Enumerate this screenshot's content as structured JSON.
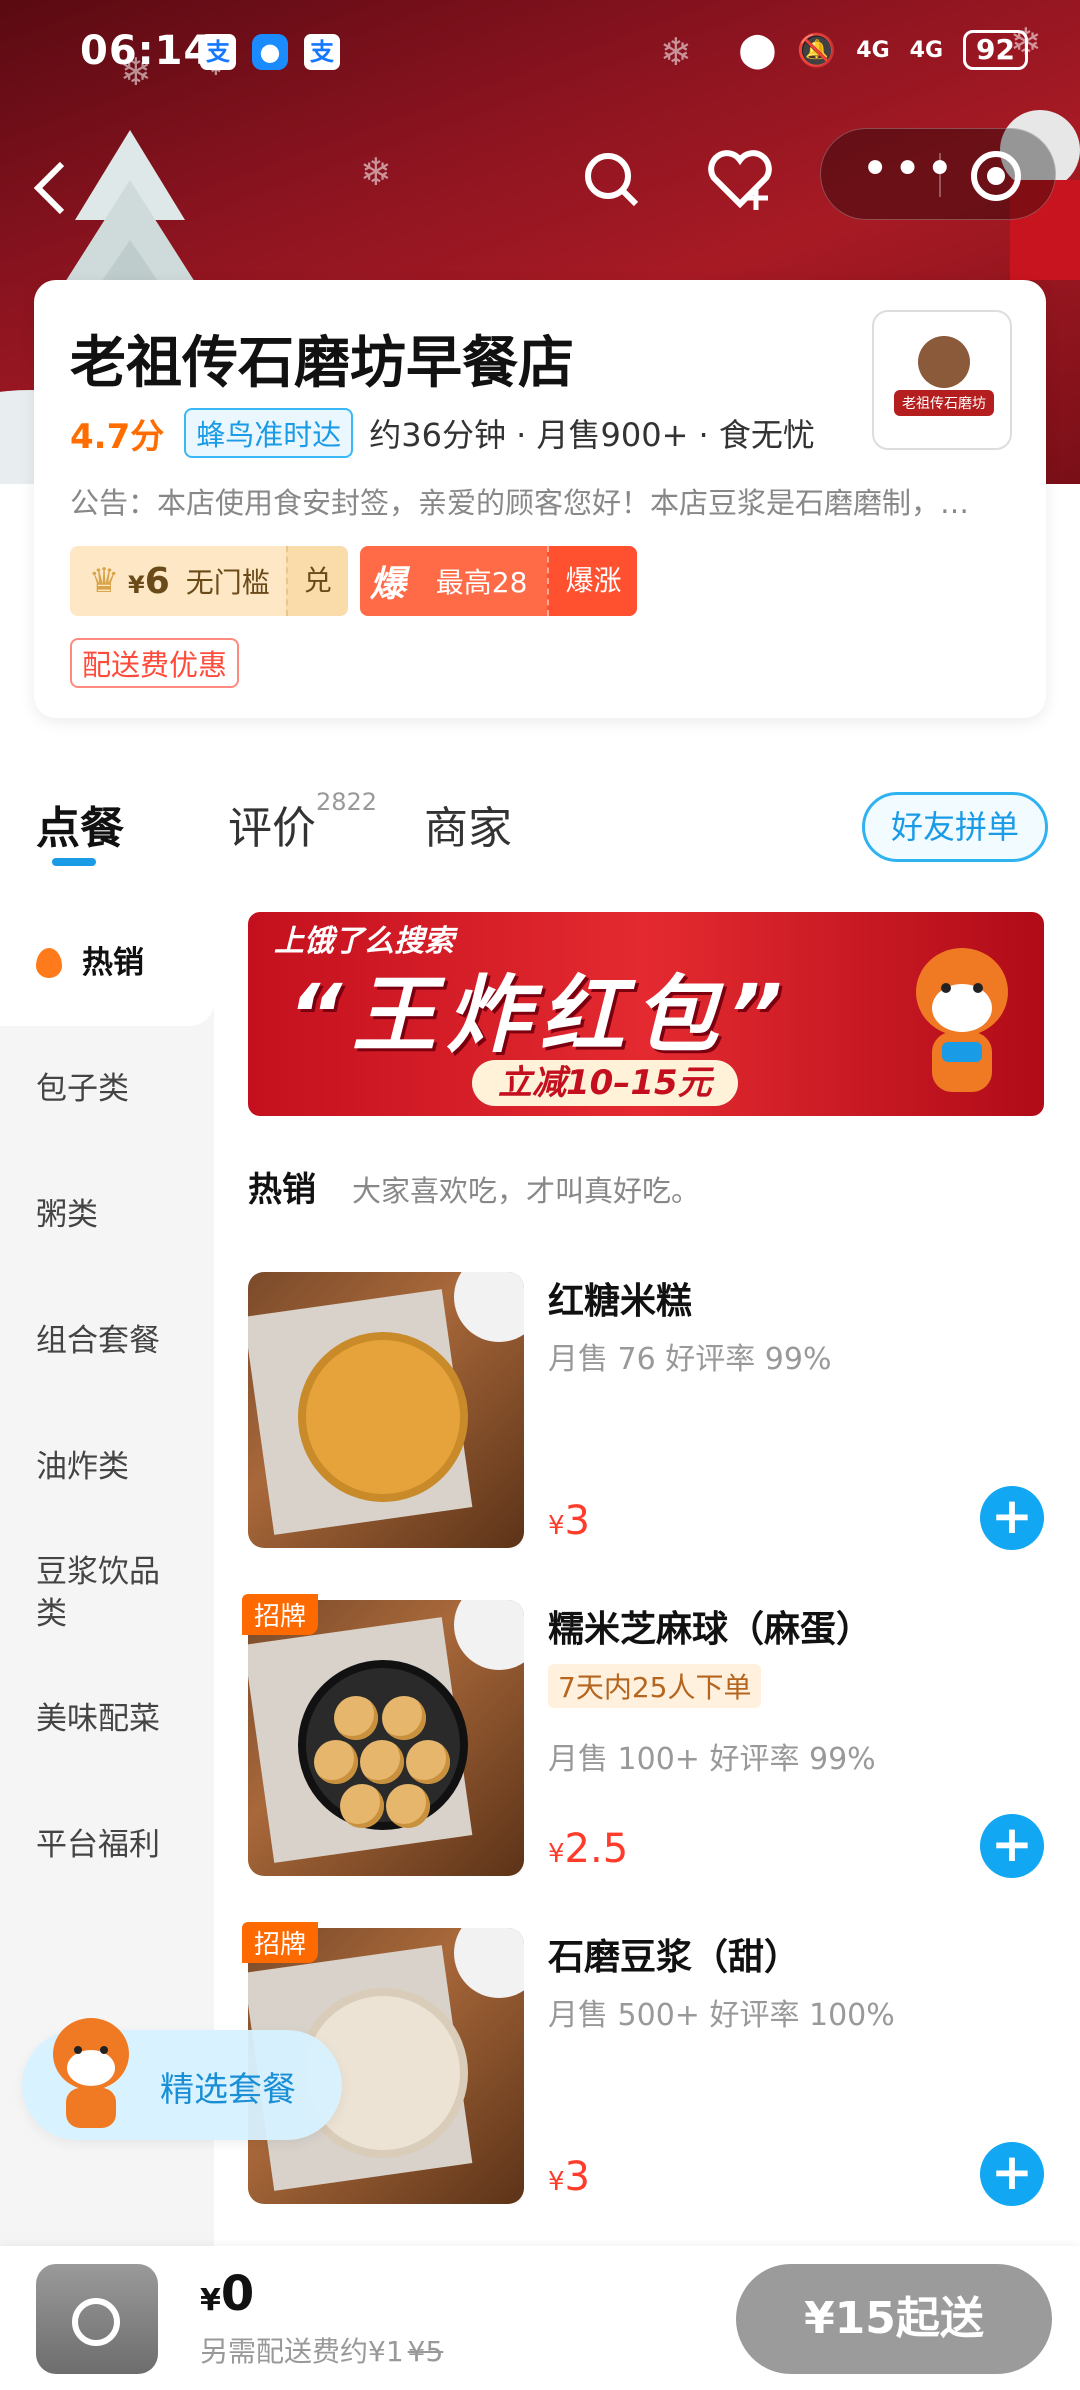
{
  "status": {
    "time": "06:14",
    "app1": "支",
    "app3": "支",
    "net1": "4G",
    "net2": "4G",
    "battery": "92"
  },
  "shop": {
    "name": "老祖传石磨坊早餐店",
    "logo_text": "老祖传石磨坊",
    "rating": "4.7分",
    "fengniao": "蜂鸟准时达",
    "meta": "约36分钟 · 月售900+ · 食无忧",
    "notice": "公告：本店使用食安封签，亲爱的顾客您好！本店豆浆是石磨磨制，欢迎品尝",
    "coupon1": {
      "amount_symbol": "¥",
      "amount": "6",
      "text": "无门槛",
      "exchange": "兑"
    },
    "coupon2": {
      "icon": "爆",
      "text": "最高28",
      "exchange": "爆涨"
    },
    "fee_tag": "配送费优惠"
  },
  "tabs": {
    "order": "点餐",
    "review": "评价",
    "review_count": "2822",
    "merchant": "商家",
    "group_button": "好友拼单"
  },
  "categories": [
    "热销",
    "包子类",
    "粥类",
    "组合套餐",
    "油炸类",
    "豆浆饮品类",
    "美味配菜",
    "平台福利"
  ],
  "banner": {
    "line1": "上饿了么搜索",
    "line2": "“王炸红包”",
    "line3": "立减10–15元"
  },
  "section": {
    "title": "热销",
    "subtitle": "大家喜欢吃，才叫真好吃。"
  },
  "products": [
    {
      "name": "红糖米糕",
      "sales": "月售 76 好评率 99%",
      "price_symbol": "¥",
      "price": "3"
    },
    {
      "badge": "招牌",
      "name": "糯米芝麻球（麻蛋）",
      "tag": "7天内25人下单",
      "sales": "月售 100+ 好评率 99%",
      "price_symbol": "¥",
      "price": "2.5"
    },
    {
      "badge": "招牌",
      "name": "石磨豆浆（甜）",
      "sales": "月售 500+ 好评率 100%",
      "price_symbol": "¥",
      "price": "3"
    }
  ],
  "float_button": "精选套餐",
  "cart": {
    "currency": "¥",
    "total": "0",
    "fee_note": "另需配送费约¥1",
    "fee_old": "¥5",
    "start_button": "¥15起送"
  },
  "colors": {
    "accent": "#12a7f2",
    "price": "#ff3b2a",
    "rating": "#ff6d00",
    "hero": "#a71a24"
  }
}
